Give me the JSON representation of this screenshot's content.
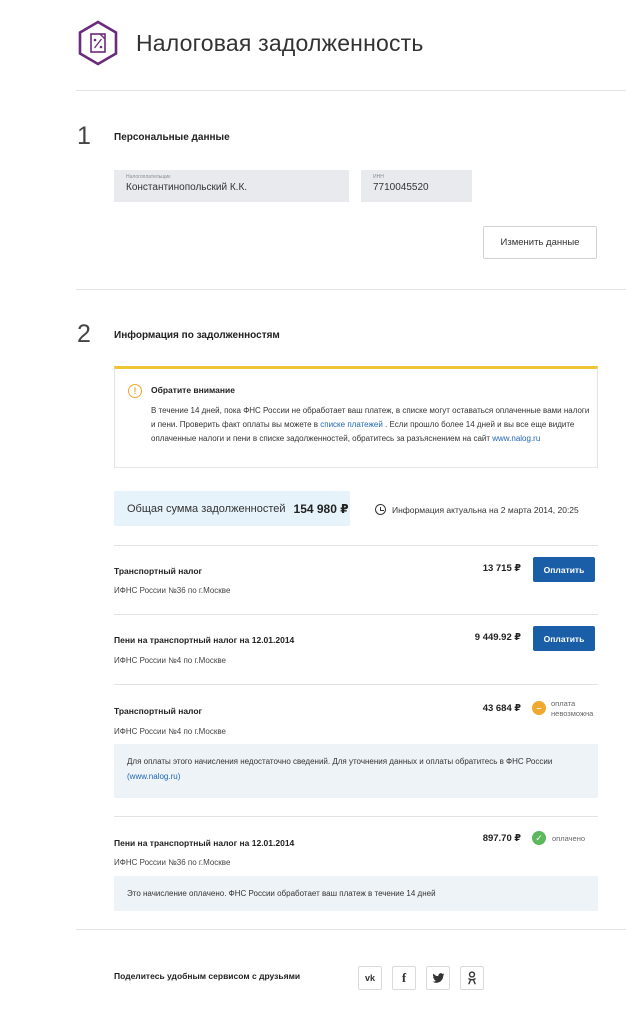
{
  "header": {
    "title": "Налоговая задолженность",
    "logo_icon": "percent-document-icon"
  },
  "section1": {
    "number": "1",
    "title": "Персональные данные",
    "taxpayer": {
      "label": "Налогоплательщик",
      "value": "Константинопольский К.К."
    },
    "inn": {
      "label": "ИНН",
      "value": "7710045520"
    },
    "edit_button": "Изменить данные"
  },
  "section2": {
    "number": "2",
    "title": "Информация по задолженностям",
    "notice": {
      "icon": "exclamation-icon",
      "title": "Обратите внимание",
      "text_part1": "В течение 14 дней, пока ФНС России не обработает ваш платеж, в списке могут оставаться оплаченные вами налоги и пени. Проверить факт оплаты вы можете в ",
      "link1": "списке платежей",
      "text_part2": " . Если прошло более 14 дней и вы все еще видите оплаченные налоги и пени в списке задолженностей, обратитесь за разъяснением на сайт ",
      "link2": "www.nalog.ru"
    },
    "total": {
      "label": "Общая сумма задолженностей",
      "value": "154 980 ₽"
    },
    "actual_info": "Информация актуальна на 2 марта 2014, 20:25",
    "debts": [
      {
        "title": "Транспортный налог",
        "authority": "ИФНС России №36 по г.Москве",
        "amount": "13 715 ₽",
        "action": "Оплатить"
      },
      {
        "title": "Пени на транспортный налог на 12.01.2014",
        "authority": "ИФНС России №4 по г.Москве",
        "amount": "9 449.92 ₽",
        "action": "Оплатить"
      },
      {
        "title": "Транспортный налог",
        "authority": "ИФНС России №4 по г.Москве",
        "amount": "43 684 ₽",
        "status_line1": "оплата",
        "status_line2": "невозможна",
        "note_part1": "Для оплаты этого начисления недостаточно сведений. Для уточнения данных и оплаты обратитесь в ФНС России ",
        "note_link": "(www.nalog.ru)"
      },
      {
        "title": "Пени на транспортный налог на 12.01.2014",
        "authority": "ИФНС России №36 по г.Москве",
        "amount": "897.70 ₽",
        "status": "оплачено",
        "note": "Это начисление оплачено. ФНС России обработает ваш платеж в течение 14 дней"
      }
    ]
  },
  "share": {
    "label": "Поделитесь удобным сервисом с друзьями",
    "networks": [
      "vk-icon",
      "facebook-icon",
      "twitter-icon",
      "odnoklassniki-icon"
    ]
  },
  "colors": {
    "brand": "#6b2a7c",
    "primary_button": "#1a5ea8",
    "warning": "#f0c534",
    "success": "#5cb85c",
    "unavailable": "#f0a82e"
  }
}
